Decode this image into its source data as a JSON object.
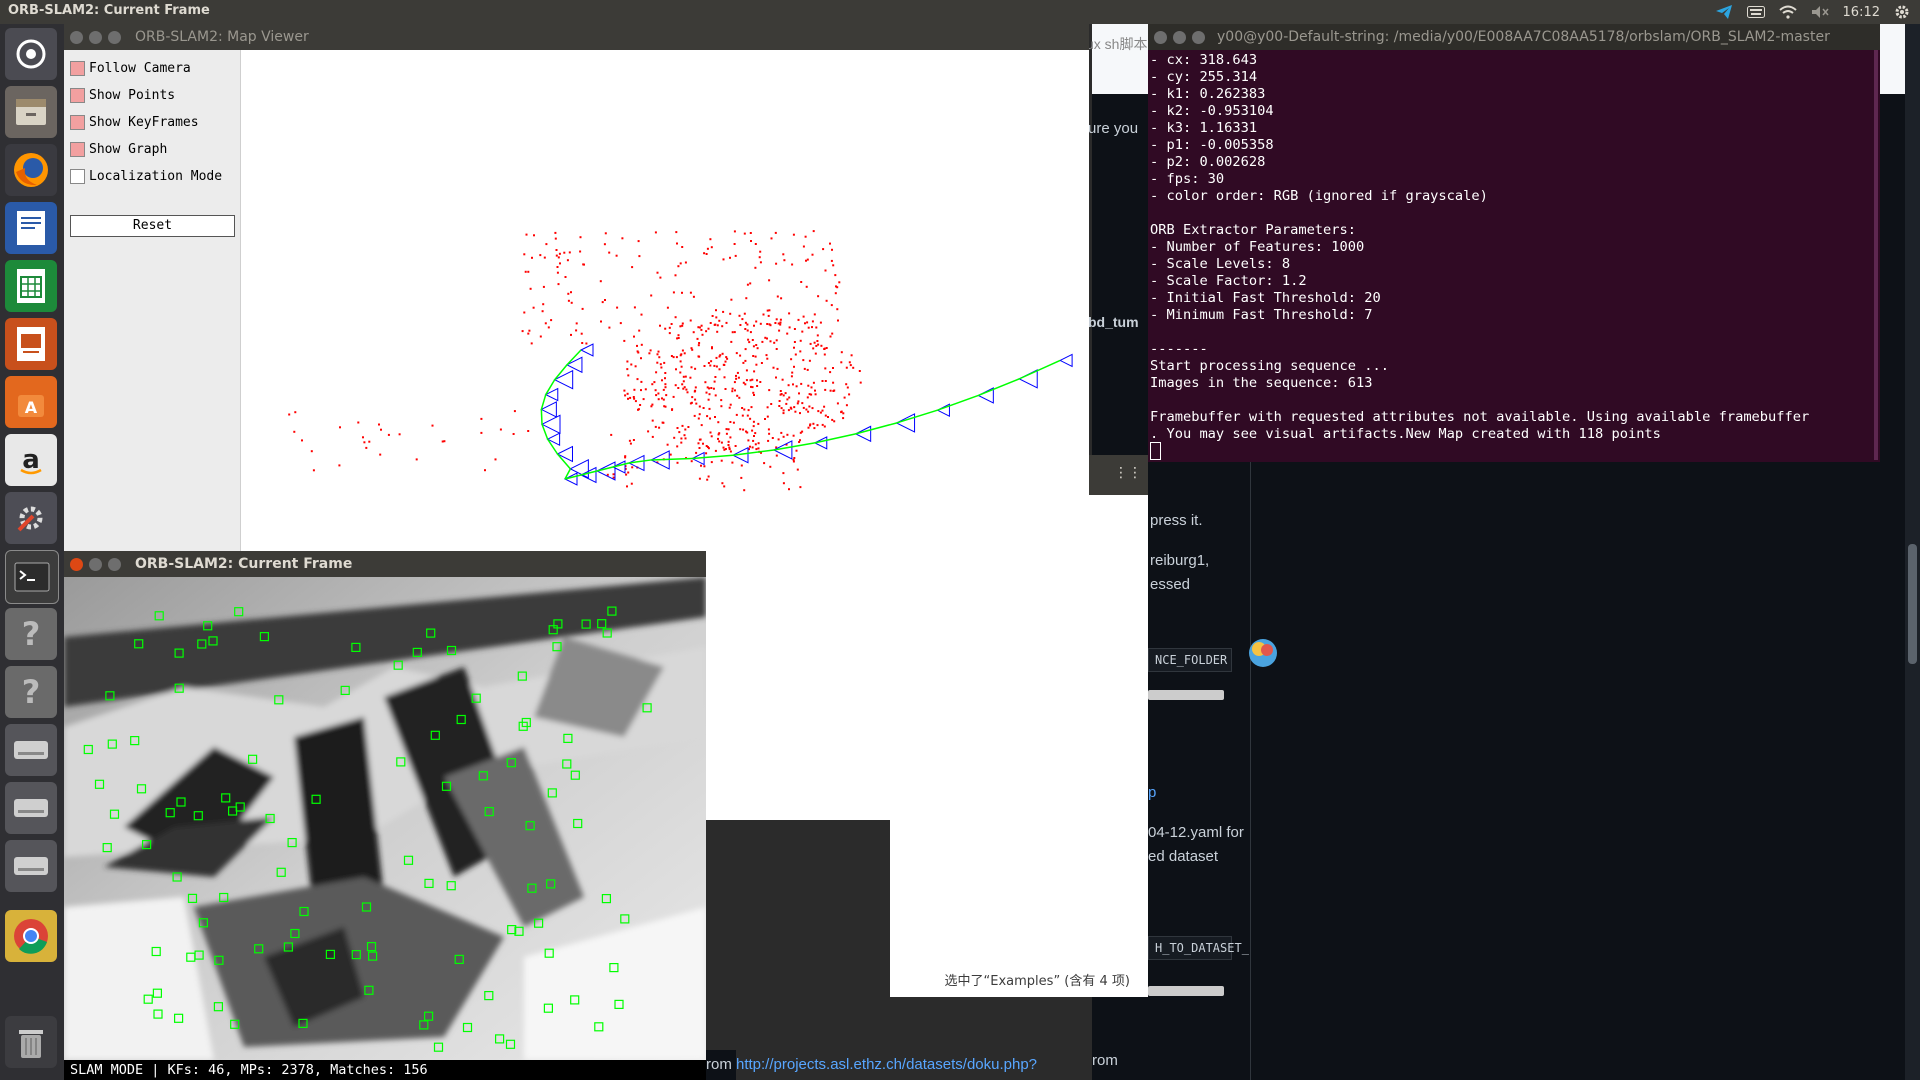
{
  "topbar": {
    "title": "ORB-SLAM2: Current Frame",
    "clock": "16:12"
  },
  "launcher": {
    "icons": [
      "dash-icon",
      "files-icon",
      "firefox-icon",
      "writer-icon",
      "calc-icon",
      "impress-icon",
      "software-center-icon",
      "amazon-icon",
      "settings-icon",
      "terminal-icon",
      "unknown-app-icon",
      "unknown-app-icon",
      "drive-icon",
      "drive-icon",
      "drive-icon",
      "chrome-icon",
      "trash-icon"
    ]
  },
  "browser": {
    "snippets": [
      "ux sh脚本",
      "ure you",
      "bd_tum",
      "press it.",
      "reiburg1,",
      "essed",
      "NCE_FOLDER",
      "p",
      "04-12.yaml for",
      "ed dataset",
      "H_TO_DATASET_",
      "rom"
    ],
    "link": "http://projects.asl.ethz.ch/datasets/doku.php?"
  },
  "filemanager": {
    "status": "选中了“Examples” (含有 4 项)"
  },
  "mapviewer": {
    "title": "ORB-SLAM2: Map Viewer",
    "options": [
      {
        "label": "Follow Camera",
        "checked": true
      },
      {
        "label": "Show Points",
        "checked": true
      },
      {
        "label": "Show KeyFrames",
        "checked": true
      },
      {
        "label": "Show Graph",
        "checked": true
      },
      {
        "label": "Localization Mode",
        "checked": false
      }
    ],
    "reset": "Reset",
    "colors": {
      "points": "#ff0000",
      "keyframes": "#0000ff",
      "graph": "#00ff00"
    }
  },
  "terminal": {
    "title": "y00@y00-Default-string: /media/y00/E008AA7C08AA5178/orbslam/ORB_SLAM2-master",
    "lines": [
      "- cx: 318.643",
      "- cy: 255.314",
      "- k1: 0.262383",
      "- k2: -0.953104",
      "- k3: 1.16331",
      "- p1: -0.005358",
      "- p2: 0.002628",
      "- fps: 30",
      "- color order: RGB (ignored if grayscale)",
      "",
      "ORB Extractor Parameters:",
      "- Number of Features: 1000",
      "- Scale Levels: 8",
      "- Scale Factor: 1.2",
      "- Initial Fast Threshold: 20",
      "- Minimum Fast Threshold: 7",
      "",
      "-------",
      "Start processing sequence ...",
      "Images in the sequence: 613",
      "",
      "Framebuffer with requested attributes not available. Using available framebuffer",
      ". You may see visual artifacts.New Map created with 118 points"
    ]
  },
  "currentframe": {
    "title": "ORB-SLAM2: Current Frame",
    "status": "SLAM MODE |  KFs: 46, MPs: 2378, Matches: 156"
  }
}
